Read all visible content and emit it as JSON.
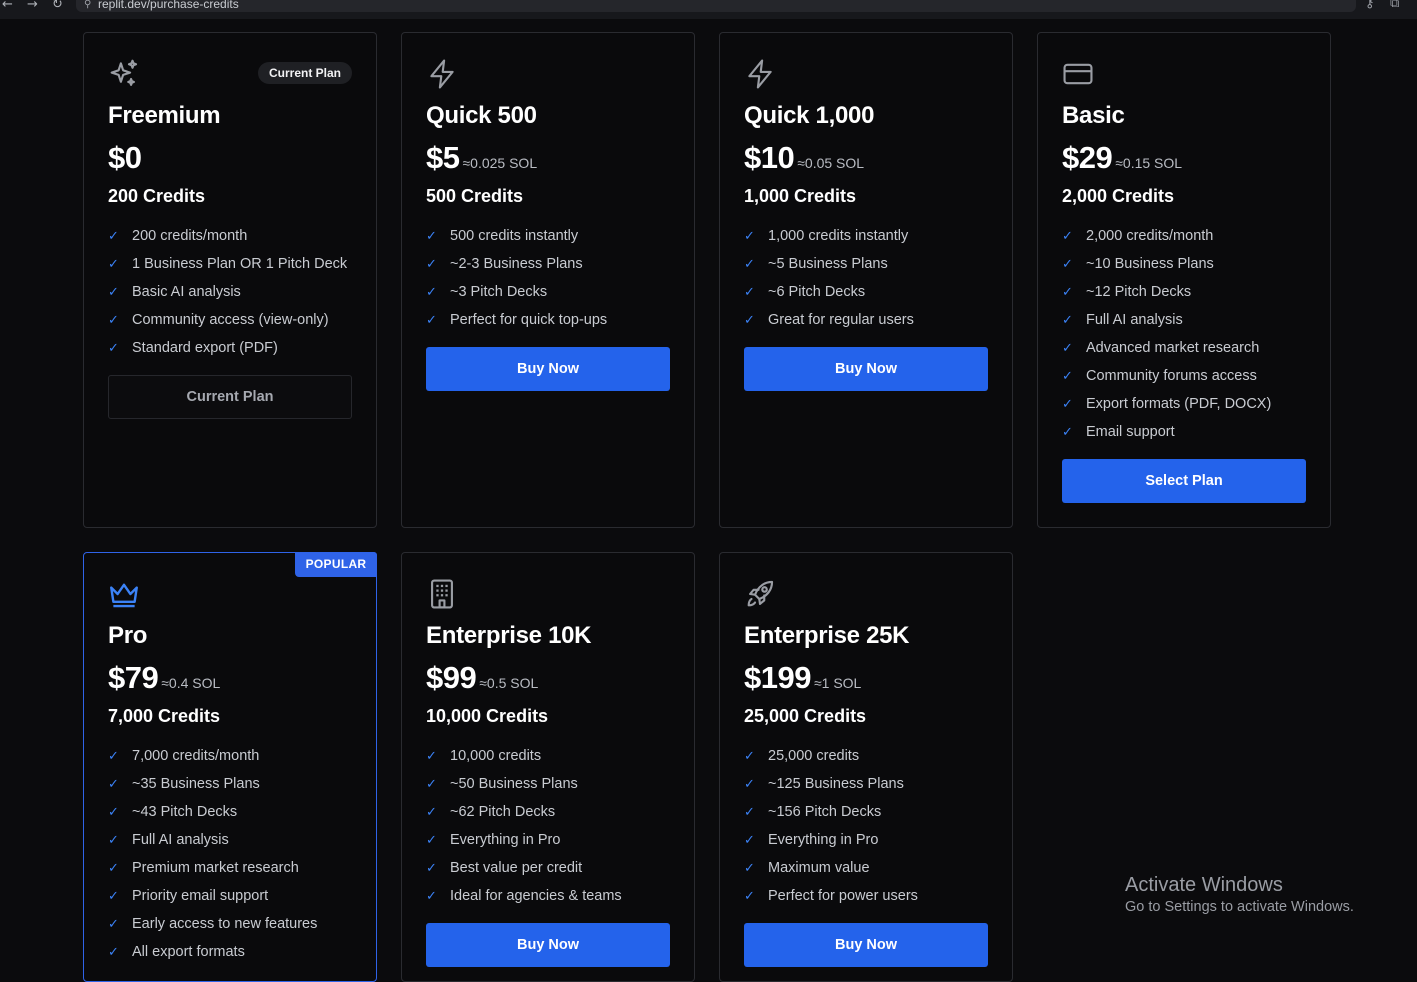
{
  "browser": {
    "url": "replit.dev/purchase-credits"
  },
  "plans": [
    {
      "icon": "sparkles-icon",
      "name": "Freemium",
      "price": "$0",
      "sol": "",
      "credits": "200 Credits",
      "badge": "Current Plan",
      "features": [
        "200 credits/month",
        "1 Business Plan OR 1 Pitch Deck",
        "Basic AI analysis",
        "Community access (view-only)",
        "Standard export (PDF)"
      ],
      "button": "Current Plan"
    },
    {
      "icon": "lightning-icon",
      "name": "Quick 500",
      "price": "$5",
      "sol": "≈0.025 SOL",
      "credits": "500 Credits",
      "features": [
        "500 credits instantly",
        "~2-3 Business Plans",
        "~3 Pitch Decks",
        "Perfect for quick top-ups"
      ],
      "button": "Buy Now"
    },
    {
      "icon": "lightning-icon",
      "name": "Quick 1,000",
      "price": "$10",
      "sol": "≈0.05 SOL",
      "credits": "1,000 Credits",
      "features": [
        "1,000 credits instantly",
        "~5 Business Plans",
        "~6 Pitch Decks",
        "Great for regular users"
      ],
      "button": "Buy Now"
    },
    {
      "icon": "credit-card-icon",
      "name": "Basic",
      "price": "$29",
      "sol": "≈0.15 SOL",
      "credits": "2,000 Credits",
      "features": [
        "2,000 credits/month",
        "~10 Business Plans",
        "~12 Pitch Decks",
        "Full AI analysis",
        "Advanced market research",
        "Community forums access",
        "Export formats (PDF, DOCX)",
        "Email support"
      ],
      "button": "Select Plan"
    },
    {
      "icon": "crown-icon",
      "name": "Pro",
      "price": "$79",
      "sol": "≈0.4 SOL",
      "credits": "7,000 Credits",
      "badge": "POPULAR",
      "features": [
        "7,000 credits/month",
        "~35 Business Plans",
        "~43 Pitch Decks",
        "Full AI analysis",
        "Premium market research",
        "Priority email support",
        "Early access to new features",
        "All export formats"
      ],
      "button": ""
    },
    {
      "icon": "building-icon",
      "name": "Enterprise 10K",
      "price": "$99",
      "sol": "≈0.5 SOL",
      "credits": "10,000 Credits",
      "features": [
        "10,000 credits",
        "~50 Business Plans",
        "~62 Pitch Decks",
        "Everything in Pro",
        "Best value per credit",
        "Ideal for agencies & teams"
      ],
      "button": "Buy Now"
    },
    {
      "icon": "rocket-icon",
      "name": "Enterprise 25K",
      "price": "$199",
      "sol": "≈1 SOL",
      "credits": "25,000 Credits",
      "features": [
        "25,000 credits",
        "~125 Business Plans",
        "~156 Pitch Decks",
        "Everything in Pro",
        "Maximum value",
        "Perfect for power users"
      ],
      "button": "Buy Now"
    }
  ],
  "watermark": {
    "title": "Activate Windows",
    "subtitle": "Go to Settings to activate Windows."
  },
  "colors": {
    "accent": "#2463eb",
    "check": "#3b82f6",
    "background": "#0b0b0d"
  }
}
